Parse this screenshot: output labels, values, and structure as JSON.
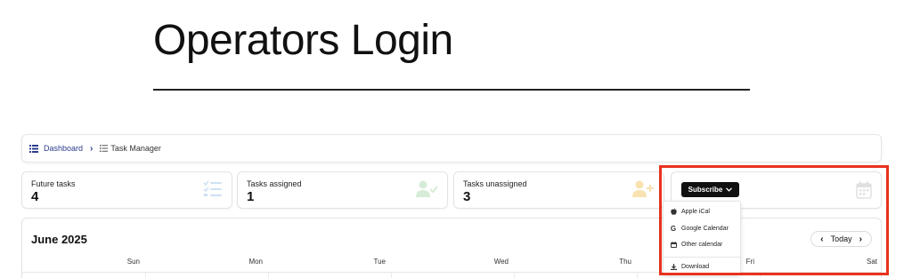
{
  "header": {
    "title": "Operators Login"
  },
  "breadcrumb": {
    "dashboard": "Dashboard",
    "current": "Task Manager"
  },
  "stats": [
    {
      "label": "Future tasks",
      "value": "4",
      "icon": "task-list-icon",
      "color": "#cfe1f3"
    },
    {
      "label": "Tasks assigned",
      "value": "1",
      "icon": "user-check-icon",
      "color": "#d6ecd6"
    },
    {
      "label": "Tasks unassigned",
      "value": "3",
      "icon": "user-plus-icon",
      "color": "#f7e2b0"
    }
  ],
  "subscribe": {
    "label": "Subscribe",
    "options": [
      {
        "label": "Apple iCal",
        "icon": "apple-icon"
      },
      {
        "label": "Google Calendar",
        "icon": "google-icon"
      },
      {
        "label": "Other calendar",
        "icon": "calendar-icon"
      },
      {
        "label": "Download",
        "icon": "download-icon"
      }
    ]
  },
  "calendar": {
    "title": "June 2025",
    "today_label": "Today",
    "days": [
      "Sun",
      "Mon",
      "Tue",
      "Wed",
      "Thu",
      "Fri",
      "Sat"
    ]
  },
  "colors": {
    "link": "#2b3c8c",
    "highlight": "#e8321e",
    "button": "#111111"
  }
}
